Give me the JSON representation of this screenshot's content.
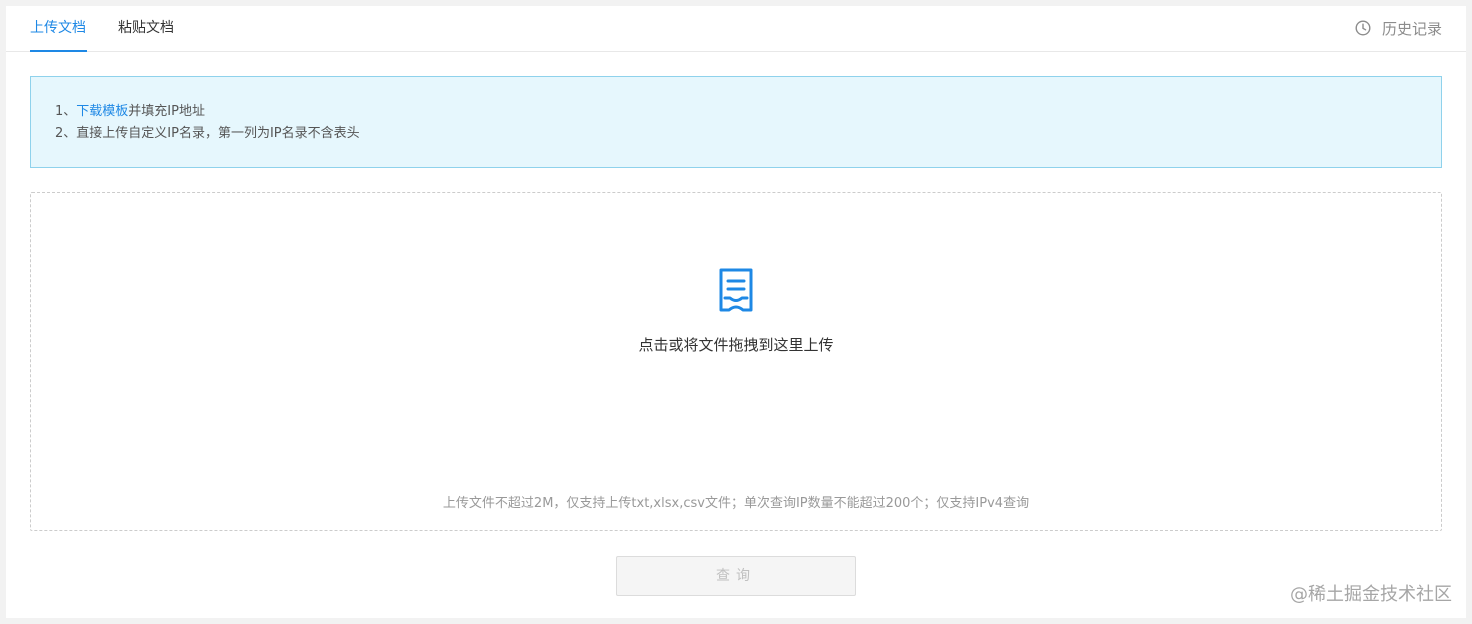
{
  "tabs": [
    {
      "label": "上传文档",
      "active": true
    },
    {
      "label": "粘贴文档",
      "active": false
    }
  ],
  "history": {
    "icon": "clock-icon",
    "label": "历史记录"
  },
  "info": {
    "line1_prefix": "1、",
    "line1_link": "下载模板",
    "line1_suffix": "并填充IP地址",
    "line2": "2、直接上传自定义IP名录，第一列为IP名录不含表头"
  },
  "upload": {
    "icon": "document-icon",
    "text": "点击或将文件拖拽到这里上传",
    "hint": "上传文件不超过2M，仅支持上传txt,xlsx,csv文件；单次查询IP数量不能超过200个；仅支持IPv4查询"
  },
  "query_button": {
    "label": "查询",
    "disabled": true
  },
  "watermark": "@稀土掘金技术社区",
  "colors": {
    "accent": "#1e88e5",
    "info_bg": "#e6f7fd",
    "info_border": "#8fd2ec"
  }
}
